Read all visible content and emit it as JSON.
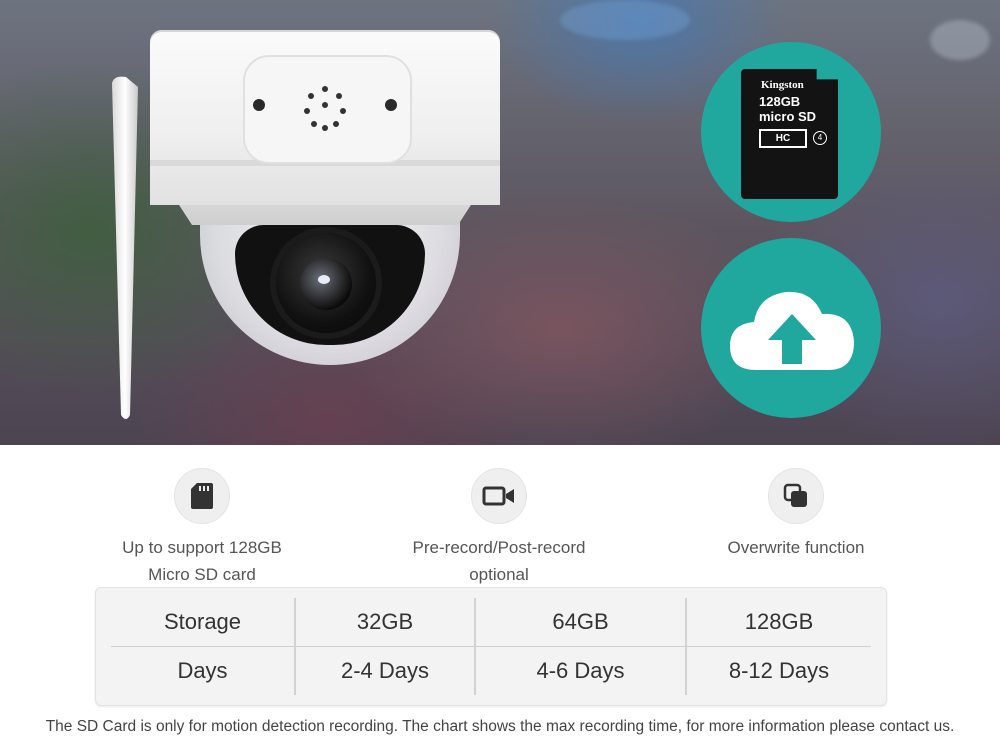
{
  "colors": {
    "accent_teal": "#20a89e",
    "text_gray": "#555555",
    "table_bg": "#f3f3f3"
  },
  "hero": {
    "sd_card": {
      "brand": "Kingston",
      "capacity": "128GB",
      "type_label": "micro SD",
      "hc_label": "HC"
    },
    "icons": [
      "dome-camera-image",
      "sd-card-icon",
      "cloud-upload-icon"
    ]
  },
  "features": [
    {
      "icon": "sd-card-icon",
      "line1": "Up to support 128GB",
      "line2": "Micro SD card"
    },
    {
      "icon": "video-camera-icon",
      "line1": "Pre-record/Post-record",
      "line2": "optional"
    },
    {
      "icon": "overwrite-icon",
      "line1": "Overwrite function",
      "line2": ""
    }
  ],
  "table": {
    "header": [
      "Storage",
      "32GB",
      "64GB",
      "128GB"
    ],
    "row": [
      "Days",
      "2-4 Days",
      "4-6 Days",
      "8-12 Days"
    ]
  },
  "footnote": "The SD Card is only for motion detection recording. The chart shows the max recording time, for more information please contact us."
}
